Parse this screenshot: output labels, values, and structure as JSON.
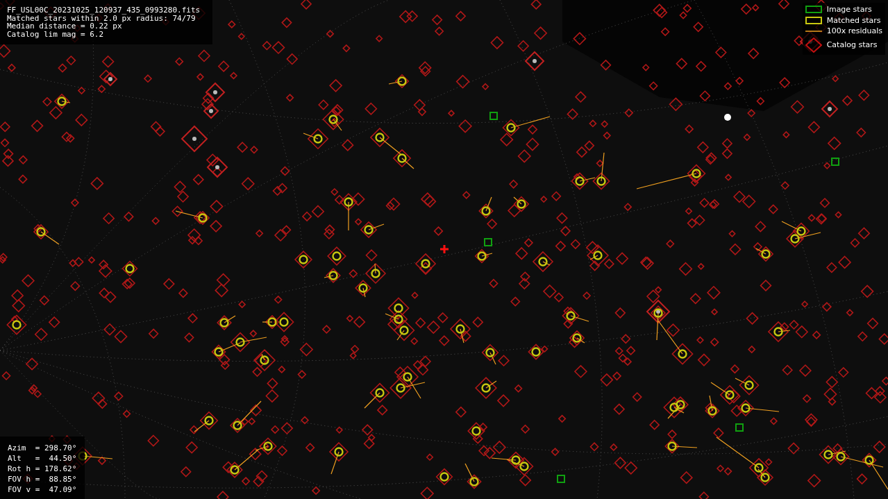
{
  "file_info": [
    "FF_USL00C_20231025_120937_435_0993280.fits",
    "Matched stars within 2.0 px radius: 74/79",
    "Median distance = 0.22 px",
    "Catalog lim mag = 6.2"
  ],
  "legend": [
    {
      "kind": "image",
      "label": "Image stars"
    },
    {
      "kind": "matched",
      "label": "Matched stars"
    },
    {
      "kind": "residual",
      "label": "100x residuals"
    },
    {
      "kind": "catalog",
      "label": "Catalog stars"
    }
  ],
  "pointing": [
    "Azim  = 298.70°",
    "Alt   =  44.50°",
    "Rot h = 178.62°",
    "FOV h =  88.85°",
    "FOV v =  47.09°"
  ]
}
